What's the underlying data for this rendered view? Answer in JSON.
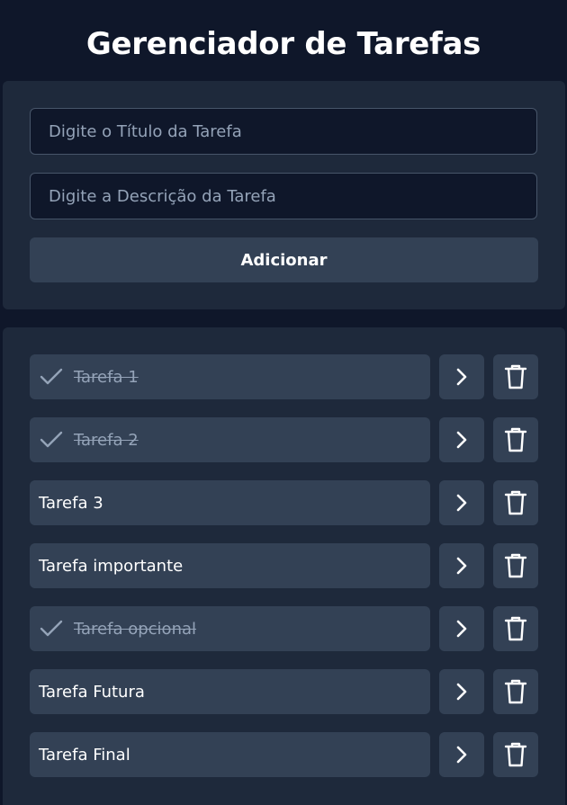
{
  "app": {
    "title": "Gerenciador de Tarefas"
  },
  "form": {
    "title_placeholder": "Digite o Título da Tarefa",
    "description_placeholder": "Digite a Descrição da Tarefa",
    "add_label": "Adicionar"
  },
  "tasks": [
    {
      "label": "Tarefa 1",
      "completed": true
    },
    {
      "label": "Tarefa 2",
      "completed": true
    },
    {
      "label": "Tarefa 3",
      "completed": false
    },
    {
      "label": "Tarefa importante",
      "completed": false
    },
    {
      "label": "Tarefa opcional",
      "completed": true
    },
    {
      "label": "Tarefa Futura",
      "completed": false
    },
    {
      "label": "Tarefa Final",
      "completed": false
    }
  ],
  "icons": {
    "completed": "check-icon",
    "open": "chevron-right-icon",
    "delete": "trash-icon"
  },
  "colors": {
    "background": "#0f172a",
    "card": "#1e293b",
    "item": "#334155",
    "muted_text": "#94a3b8"
  }
}
